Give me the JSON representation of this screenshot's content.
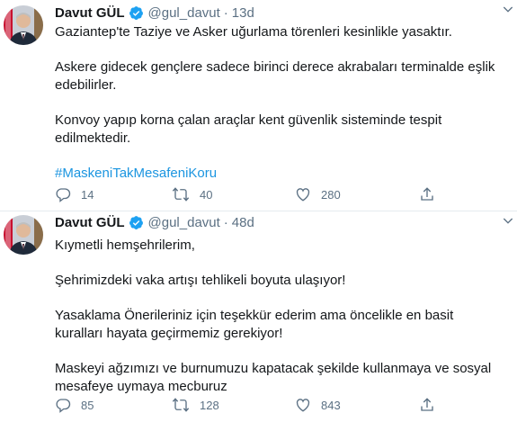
{
  "tweets": [
    {
      "author_name": "Davut GÜL",
      "handle": "@gul_davut",
      "separator": "·",
      "time": "13d",
      "paragraphs": [
        "Gaziantep'te Taziye ve Asker uğurlama törenleri kesinlikle yasaktır.",
        "Askere gidecek gençlere sadece birinci derece akrabaları terminalde eşlik edebilirler.",
        "Konvoy yapıp korna çalan araçlar  kent güvenlik sisteminde tespit edilmektedir."
      ],
      "hashtag": "#MaskeniTakMesafeniKoru",
      "replies": "14",
      "retweets": "40",
      "likes": "280"
    },
    {
      "author_name": "Davut GÜL",
      "handle": "@gul_davut",
      "separator": "·",
      "time": "48d",
      "paragraphs": [
        "Kıymetli hemşehrilerim,",
        "Şehrimizdeki vaka artışı tehlikeli boyuta ulaşıyor!",
        "Yasaklama Önerileriniz için teşekkür ederim ama  öncelikle en basit kuralları hayata geçirmemiz gerekiyor!",
        "Maskeyi ağzımızı ve burnumuzu kapatacak şekilde kullanmaya ve sosyal mesafeye uymaya mecburuz"
      ],
      "replies": "85",
      "retweets": "128",
      "likes": "843"
    }
  ],
  "icons": {
    "verified": "verified-badge-icon",
    "caret": "chevron-down-icon",
    "reply": "reply-icon",
    "retweet": "retweet-icon",
    "like": "heart-icon",
    "share": "share-icon"
  },
  "colors": {
    "verified": "#1da1f2",
    "hashtag": "#1b95e0",
    "secondary_text": "#5b7083",
    "divider": "#e6ecf0"
  }
}
